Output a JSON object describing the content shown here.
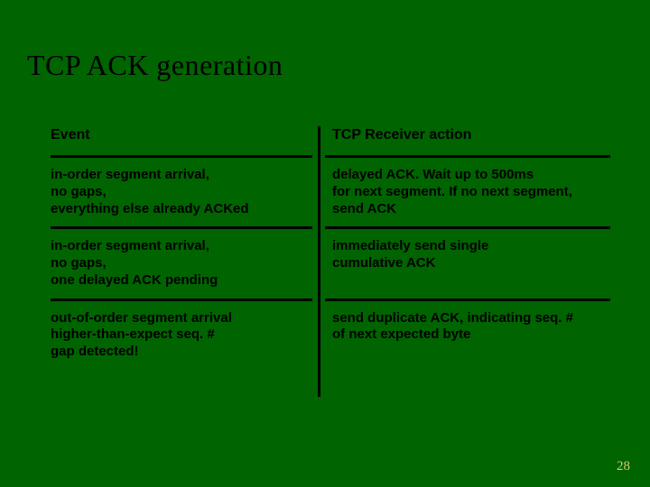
{
  "title": "TCP ACK generation",
  "headers": {
    "left": "Event",
    "right": "TCP Receiver action"
  },
  "rows": [
    {
      "event": "in-order segment arrival,\nno gaps,\neverything else already ACKed",
      "action": "delayed ACK. Wait up to 500ms\nfor next segment. If no next segment,\nsend ACK"
    },
    {
      "event": "in-order segment arrival,\nno gaps,\none delayed ACK pending",
      "action": "immediately send single\ncumulative ACK"
    },
    {
      "event": "out-of-order segment arrival\nhigher-than-expect seq. #\ngap detected!",
      "action": "send duplicate ACK, indicating seq. #\nof next expected byte"
    }
  ],
  "page_number": "28"
}
